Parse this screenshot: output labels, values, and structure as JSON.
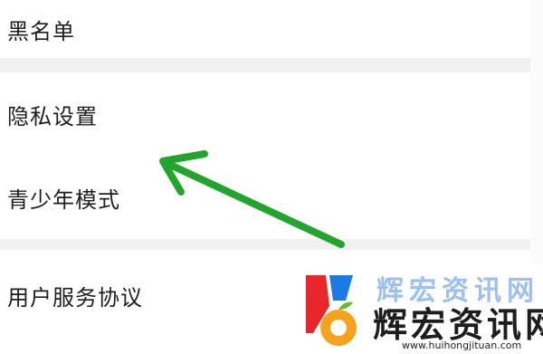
{
  "settings": {
    "items": [
      {
        "label": "黑名单"
      },
      {
        "label": "隐私设置"
      },
      {
        "label": "青少年模式"
      },
      {
        "label": "用户服务协议"
      }
    ]
  },
  "annotation": {
    "arrow_color": "#22a52c",
    "points_to": "隐私设置"
  },
  "watermark": {
    "title_faded": "辉宏资讯网",
    "title": "辉宏资讯网",
    "url": "www.huihongjituan.com",
    "colors": {
      "red": "#e8262a",
      "blue": "#1b7be6",
      "orange": "#f7a21c",
      "green": "#5cbf2a"
    }
  }
}
